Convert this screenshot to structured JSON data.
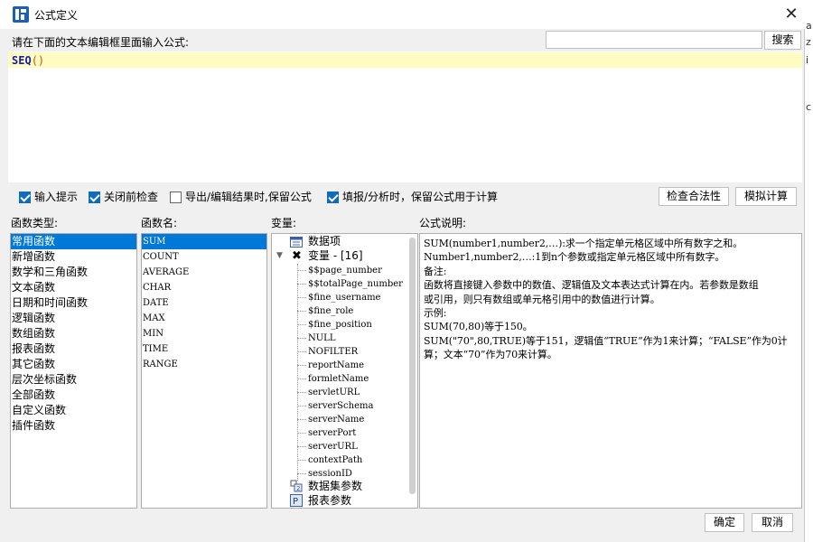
{
  "window": {
    "title": "公式定义"
  },
  "prompt_label": "请在下面的文本编辑框里面输入公式:",
  "search": {
    "value": "",
    "placeholder": "",
    "button_label": "搜索"
  },
  "editor": {
    "function_name": "SEQ",
    "open_paren": "(",
    "close_paren": ")"
  },
  "options": [
    {
      "label": "输入提示",
      "checked": true
    },
    {
      "label": "关闭前检查",
      "checked": true
    },
    {
      "label": "导出/编辑结果时,保留公式",
      "checked": false
    },
    {
      "label": "填报/分析时，保留公式用于计算",
      "checked": true
    }
  ],
  "actions": {
    "check_validity_label": "检查合法性",
    "simulate_label": "模拟计算"
  },
  "categories": {
    "header": "函数类型:",
    "items": [
      "常用函数",
      "新增函数",
      "数学和三角函数",
      "文本函数",
      "日期和时间函数",
      "逻辑函数",
      "数组函数",
      "报表函数",
      "其它函数",
      "层次坐标函数",
      "全部函数",
      "自定义函数",
      "插件函数"
    ],
    "selected": "常用函数"
  },
  "functions": {
    "header": "函数名:",
    "items": [
      "SUM",
      "COUNT",
      "AVERAGE",
      "CHAR",
      "DATE",
      "MAX",
      "MIN",
      "TIME",
      "RANGE"
    ],
    "selected": "SUM"
  },
  "variables": {
    "header": "变量:",
    "data_items_label": "数据项",
    "variables_label": "变量 - [16]",
    "variables_list": [
      "$$page_number",
      "$$totalPage_number",
      "$fine_username",
      "$fine_role",
      "$fine_position",
      "NULL",
      "NOFILTER",
      "reportName",
      "formletName",
      "servletURL",
      "serverSchema",
      "serverName",
      "serverPort",
      "serverURL",
      "contextPath",
      "sessionID"
    ],
    "dataset_params_label": "数据集参数",
    "report_params_label": "报表参数"
  },
  "description": {
    "header": "公式说明:",
    "lines": [
      "SUM(number1,number2,…):求一个指定单元格区域中所有数字之和。",
      "Number1,number2,…:1到n个参数或指定单元格区域中所有数字。",
      "备注:",
      "函数将直接键入参数中的数值、逻辑值及文本表达式计算在内。若参数是数组",
      "或引用，则只有数组或单元格引用中的数值进行计算。",
      "示例:",
      "SUM(70,80)等于150。",
      "SUM(\"70\",80,TRUE)等于151，逻辑值“TRUE”作为1来计算；“FALSE”作为0计",
      "算；文本“70”作为70来计算。"
    ]
  },
  "footer": {
    "ok_label": "确定",
    "cancel_label": "取消"
  },
  "icons": {
    "app": "app-logo-icon",
    "close": "close-icon",
    "data_items": "data-items-icon",
    "variables": "variables-icon",
    "dataset_params": "dataset-params-icon",
    "report_params": "report-params-icon"
  },
  "colors": {
    "accent": "#0078d7",
    "checkbox": "#0f6cbd",
    "editor_highlight": "#fdfdc2"
  }
}
